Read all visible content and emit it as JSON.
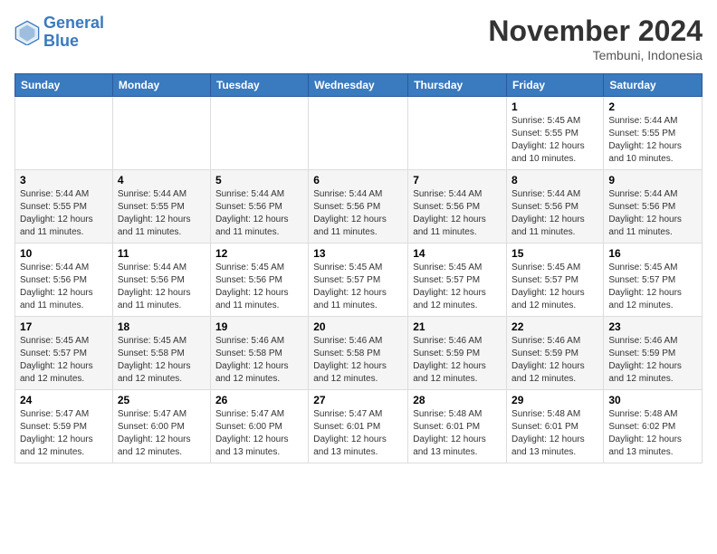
{
  "header": {
    "logo_line1": "General",
    "logo_line2": "Blue",
    "month_title": "November 2024",
    "location": "Tembuni, Indonesia"
  },
  "weekdays": [
    "Sunday",
    "Monday",
    "Tuesday",
    "Wednesday",
    "Thursday",
    "Friday",
    "Saturday"
  ],
  "weeks": [
    [
      {
        "day": "",
        "info": ""
      },
      {
        "day": "",
        "info": ""
      },
      {
        "day": "",
        "info": ""
      },
      {
        "day": "",
        "info": ""
      },
      {
        "day": "",
        "info": ""
      },
      {
        "day": "1",
        "info": "Sunrise: 5:45 AM\nSunset: 5:55 PM\nDaylight: 12 hours\nand 10 minutes."
      },
      {
        "day": "2",
        "info": "Sunrise: 5:44 AM\nSunset: 5:55 PM\nDaylight: 12 hours\nand 10 minutes."
      }
    ],
    [
      {
        "day": "3",
        "info": "Sunrise: 5:44 AM\nSunset: 5:55 PM\nDaylight: 12 hours\nand 11 minutes."
      },
      {
        "day": "4",
        "info": "Sunrise: 5:44 AM\nSunset: 5:55 PM\nDaylight: 12 hours\nand 11 minutes."
      },
      {
        "day": "5",
        "info": "Sunrise: 5:44 AM\nSunset: 5:56 PM\nDaylight: 12 hours\nand 11 minutes."
      },
      {
        "day": "6",
        "info": "Sunrise: 5:44 AM\nSunset: 5:56 PM\nDaylight: 12 hours\nand 11 minutes."
      },
      {
        "day": "7",
        "info": "Sunrise: 5:44 AM\nSunset: 5:56 PM\nDaylight: 12 hours\nand 11 minutes."
      },
      {
        "day": "8",
        "info": "Sunrise: 5:44 AM\nSunset: 5:56 PM\nDaylight: 12 hours\nand 11 minutes."
      },
      {
        "day": "9",
        "info": "Sunrise: 5:44 AM\nSunset: 5:56 PM\nDaylight: 12 hours\nand 11 minutes."
      }
    ],
    [
      {
        "day": "10",
        "info": "Sunrise: 5:44 AM\nSunset: 5:56 PM\nDaylight: 12 hours\nand 11 minutes."
      },
      {
        "day": "11",
        "info": "Sunrise: 5:44 AM\nSunset: 5:56 PM\nDaylight: 12 hours\nand 11 minutes."
      },
      {
        "day": "12",
        "info": "Sunrise: 5:45 AM\nSunset: 5:56 PM\nDaylight: 12 hours\nand 11 minutes."
      },
      {
        "day": "13",
        "info": "Sunrise: 5:45 AM\nSunset: 5:57 PM\nDaylight: 12 hours\nand 11 minutes."
      },
      {
        "day": "14",
        "info": "Sunrise: 5:45 AM\nSunset: 5:57 PM\nDaylight: 12 hours\nand 12 minutes."
      },
      {
        "day": "15",
        "info": "Sunrise: 5:45 AM\nSunset: 5:57 PM\nDaylight: 12 hours\nand 12 minutes."
      },
      {
        "day": "16",
        "info": "Sunrise: 5:45 AM\nSunset: 5:57 PM\nDaylight: 12 hours\nand 12 minutes."
      }
    ],
    [
      {
        "day": "17",
        "info": "Sunrise: 5:45 AM\nSunset: 5:57 PM\nDaylight: 12 hours\nand 12 minutes."
      },
      {
        "day": "18",
        "info": "Sunrise: 5:45 AM\nSunset: 5:58 PM\nDaylight: 12 hours\nand 12 minutes."
      },
      {
        "day": "19",
        "info": "Sunrise: 5:46 AM\nSunset: 5:58 PM\nDaylight: 12 hours\nand 12 minutes."
      },
      {
        "day": "20",
        "info": "Sunrise: 5:46 AM\nSunset: 5:58 PM\nDaylight: 12 hours\nand 12 minutes."
      },
      {
        "day": "21",
        "info": "Sunrise: 5:46 AM\nSunset: 5:59 PM\nDaylight: 12 hours\nand 12 minutes."
      },
      {
        "day": "22",
        "info": "Sunrise: 5:46 AM\nSunset: 5:59 PM\nDaylight: 12 hours\nand 12 minutes."
      },
      {
        "day": "23",
        "info": "Sunrise: 5:46 AM\nSunset: 5:59 PM\nDaylight: 12 hours\nand 12 minutes."
      }
    ],
    [
      {
        "day": "24",
        "info": "Sunrise: 5:47 AM\nSunset: 5:59 PM\nDaylight: 12 hours\nand 12 minutes."
      },
      {
        "day": "25",
        "info": "Sunrise: 5:47 AM\nSunset: 6:00 PM\nDaylight: 12 hours\nand 12 minutes."
      },
      {
        "day": "26",
        "info": "Sunrise: 5:47 AM\nSunset: 6:00 PM\nDaylight: 12 hours\nand 13 minutes."
      },
      {
        "day": "27",
        "info": "Sunrise: 5:47 AM\nSunset: 6:01 PM\nDaylight: 12 hours\nand 13 minutes."
      },
      {
        "day": "28",
        "info": "Sunrise: 5:48 AM\nSunset: 6:01 PM\nDaylight: 12 hours\nand 13 minutes."
      },
      {
        "day": "29",
        "info": "Sunrise: 5:48 AM\nSunset: 6:01 PM\nDaylight: 12 hours\nand 13 minutes."
      },
      {
        "day": "30",
        "info": "Sunrise: 5:48 AM\nSunset: 6:02 PM\nDaylight: 12 hours\nand 13 minutes."
      }
    ]
  ]
}
